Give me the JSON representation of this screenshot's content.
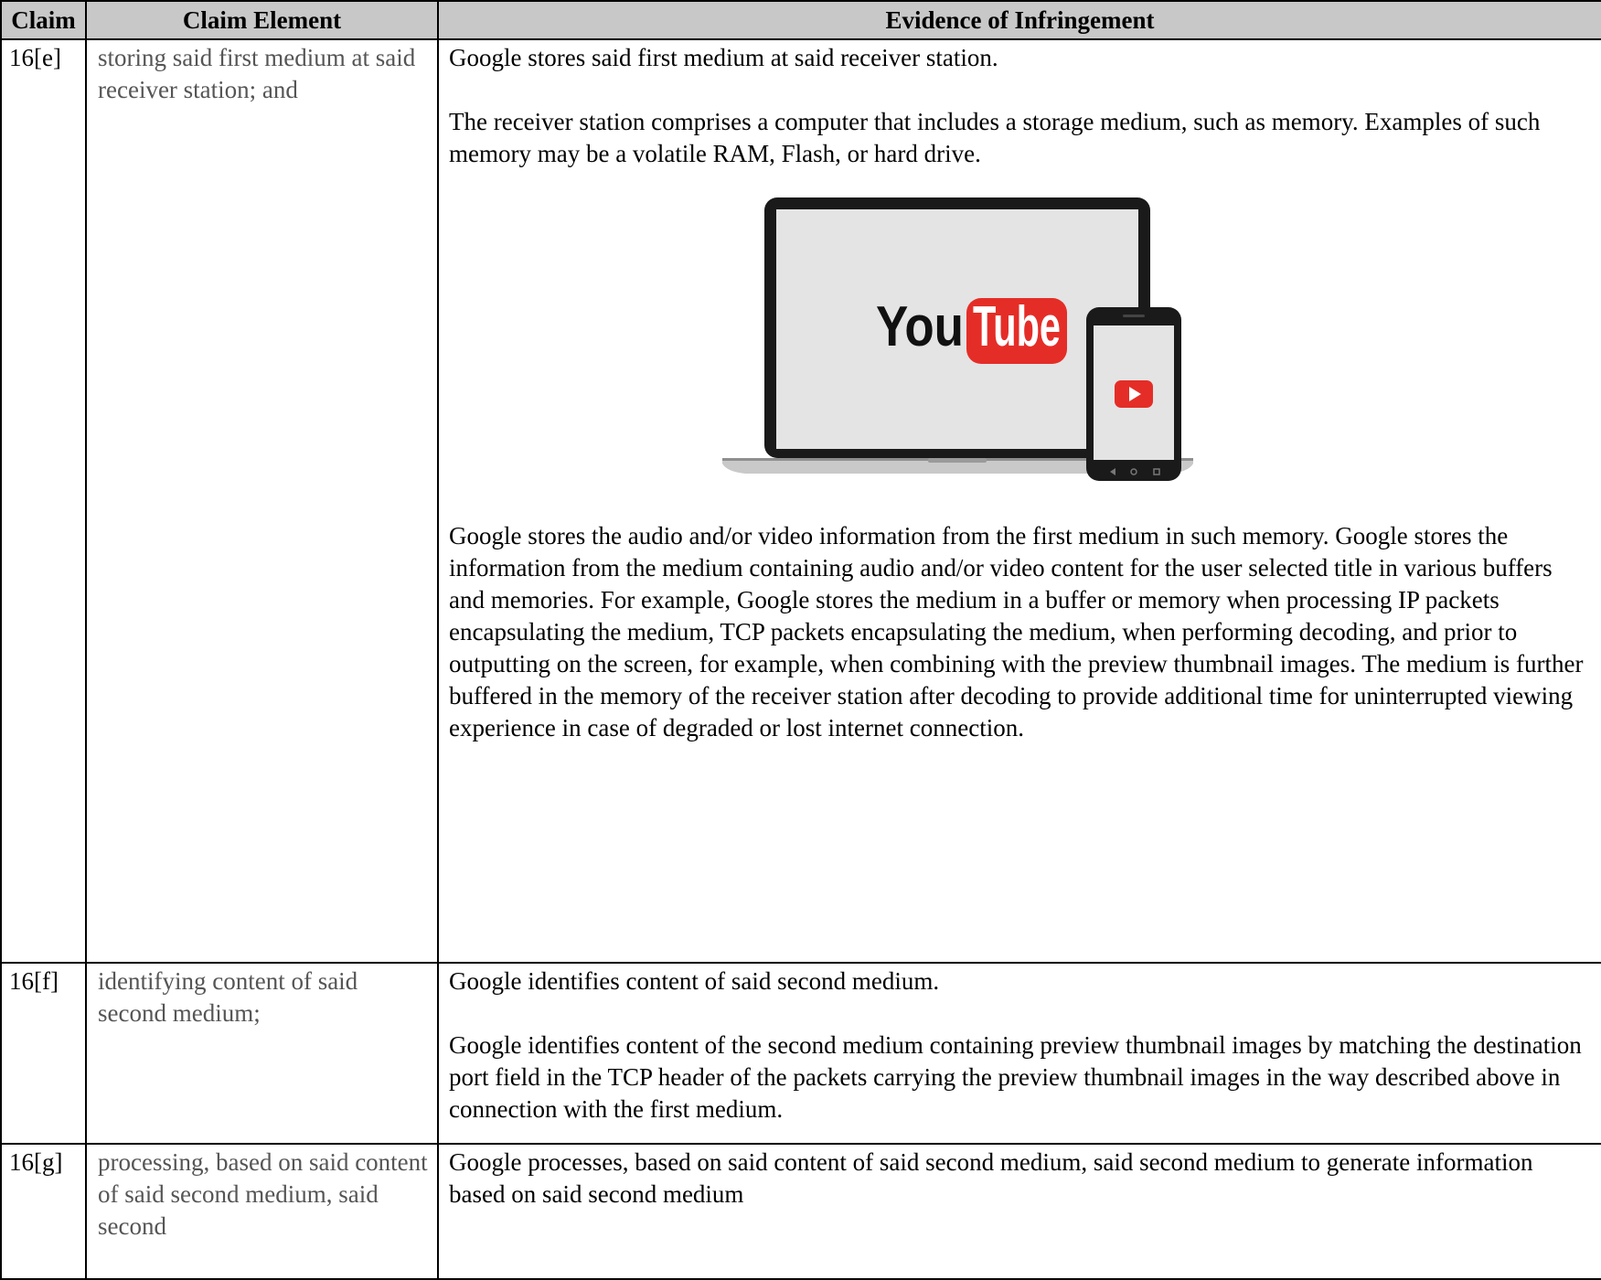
{
  "table": {
    "headers": [
      "Claim",
      "Claim Element",
      "Evidence of Infringement"
    ],
    "rows": [
      {
        "claim": "16[e]",
        "element": "storing said first medium at said receiver station; and",
        "evidence": [
          "Google stores said first medium at said receiver station.",
          "The receiver station comprises a computer that includes a storage medium, such as memory. Examples of such memory may be a volatile RAM, Flash, or hard drive.",
          "Google stores the audio and/or video information from the first medium in such memory. Google stores the information from the medium containing audio and/or video content for the user selected title in various buffers and memories.  For example, Google stores the medium in a buffer or memory when processing IP packets encapsulating the medium, TCP packets encapsulating the medium, when performing decoding, and prior to outputting on the screen, for example, when combining with the preview thumbnail images.  The medium is further buffered in the memory of the receiver station after decoding to provide additional time for uninterrupted viewing experience in case of degraded or lost internet connection."
        ]
      },
      {
        "claim": "16[f]",
        "element": "identifying content of said second medium;",
        "evidence": [
          "Google identifies content of said second medium.",
          "Google identifies content of the second medium containing preview thumbnail images by matching the destination port field in the TCP header of the packets carrying the preview thumbnail images in the way described above in connection with the first medium."
        ]
      },
      {
        "claim": "16[g]",
        "element": "processing, based on said content of said second medium, said second",
        "evidence": [
          "Google processes, based on said content of said second medium, said second medium to generate information based on said second medium"
        ]
      }
    ]
  },
  "figure": {
    "logo_you": "You",
    "logo_tube": "Tube",
    "colors": {
      "brand_red": "#e52d27",
      "screen": "#e4e4e4",
      "bezel": "#1a1a1a",
      "header_gray": "#c8c8c8",
      "element_text": "#555555"
    }
  }
}
